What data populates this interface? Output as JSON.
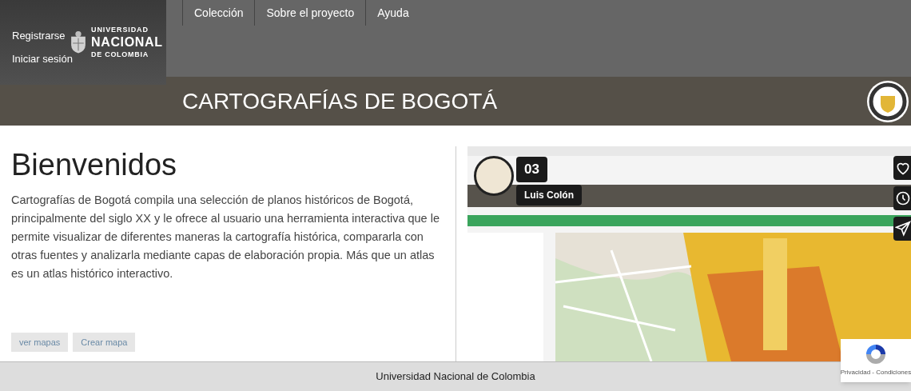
{
  "header": {
    "logo": {
      "line_1": "UNIVERSIDAD",
      "line_2": "NACIONAL",
      "line_3": "DE COLOMBIA"
    },
    "account_links": [
      "Registrarse",
      "Iniciar sesión"
    ],
    "nav": [
      "Colección",
      "Sobre el proyecto",
      "Ayuda"
    ],
    "title": "CARTOGRAFÍAS DE BOGOTÁ"
  },
  "intro": {
    "heading": "Bienvenidos",
    "text": "Cartografías de Bogotá compila una selección de planos históricos de Bogotá, principalmente del siglo XX y le ofrece al usuario una herramienta interactiva que le permite visualizar de diferentes maneras la cartografía histórica, compararla con otras fuentes y analizarla mediante capas de elaboración propia. Más que un atlas es un atlas histórico interactivo.",
    "buttons": [
      "ver mapas",
      "Crear mapa"
    ]
  },
  "video": {
    "kind": "picture",
    "counter": "03",
    "author": "Luis Colón",
    "actions": [
      {
        "kind": "like"
      },
      {
        "kind": "watch-later"
      },
      {
        "kind": "share"
      }
    ]
  },
  "recaptcha": {
    "text": "Privacidad - Condiciones"
  },
  "footer": "Universidad Nacional de Colombia"
}
